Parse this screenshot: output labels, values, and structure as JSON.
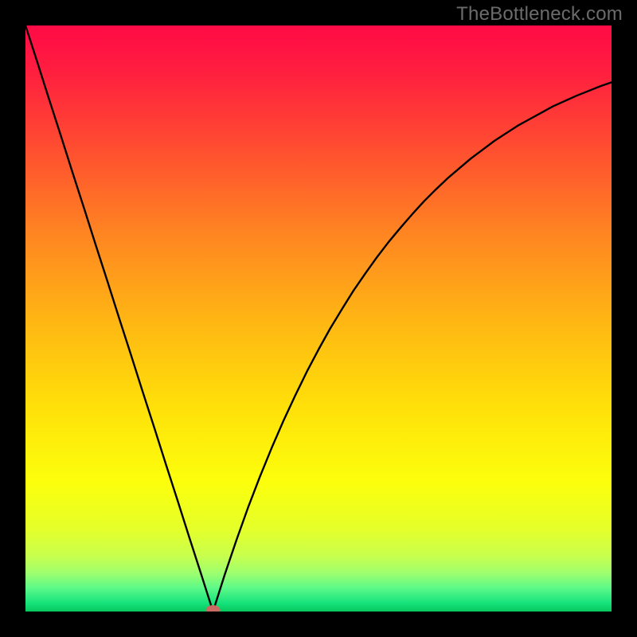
{
  "watermark": "TheBottleneck.com",
  "chart_data": {
    "type": "line",
    "title": "",
    "xlabel": "",
    "ylabel": "",
    "xlim": [
      0,
      1
    ],
    "ylim": [
      0,
      1
    ],
    "x_min_point": 0.32,
    "series": [
      {
        "name": "bottleneck-curve",
        "description": "V-shaped curve dipping to 0 near x≈0.32; left branch nearly linear rising to top-left corner; right branch concave rising toward top-right but below the top edge.",
        "x": [
          0.0,
          0.02,
          0.04,
          0.06,
          0.08,
          0.1,
          0.12,
          0.14,
          0.16,
          0.18,
          0.2,
          0.22,
          0.24,
          0.26,
          0.28,
          0.3,
          0.32,
          0.34,
          0.36,
          0.38,
          0.4,
          0.42,
          0.44,
          0.46,
          0.48,
          0.5,
          0.52,
          0.54,
          0.56,
          0.58,
          0.6,
          0.62,
          0.64,
          0.66,
          0.68,
          0.7,
          0.72,
          0.74,
          0.76,
          0.78,
          0.8,
          0.82,
          0.84,
          0.86,
          0.88,
          0.9,
          0.92,
          0.94,
          0.96,
          0.98,
          1.0
        ],
        "y": [
          1.0,
          0.938,
          0.875,
          0.813,
          0.75,
          0.688,
          0.625,
          0.563,
          0.5,
          0.438,
          0.375,
          0.313,
          0.25,
          0.188,
          0.125,
          0.063,
          0.0,
          0.063,
          0.122,
          0.178,
          0.23,
          0.279,
          0.325,
          0.368,
          0.409,
          0.447,
          0.483,
          0.516,
          0.548,
          0.577,
          0.605,
          0.631,
          0.655,
          0.678,
          0.7,
          0.72,
          0.739,
          0.756,
          0.773,
          0.788,
          0.803,
          0.816,
          0.829,
          0.84,
          0.851,
          0.862,
          0.871,
          0.88,
          0.888,
          0.896,
          0.903
        ]
      }
    ],
    "gradient_stops": [
      {
        "offset": 0.0,
        "color": "#ff0a46"
      },
      {
        "offset": 0.08,
        "color": "#ff1f3f"
      },
      {
        "offset": 0.2,
        "color": "#ff4a31"
      },
      {
        "offset": 0.35,
        "color": "#ff8322"
      },
      {
        "offset": 0.5,
        "color": "#ffb514"
      },
      {
        "offset": 0.65,
        "color": "#ffe009"
      },
      {
        "offset": 0.78,
        "color": "#fcff0c"
      },
      {
        "offset": 0.86,
        "color": "#e4ff2a"
      },
      {
        "offset": 0.905,
        "color": "#c8ff4d"
      },
      {
        "offset": 0.935,
        "color": "#9dff6f"
      },
      {
        "offset": 0.96,
        "color": "#5cf989"
      },
      {
        "offset": 0.985,
        "color": "#17e37c"
      },
      {
        "offset": 1.0,
        "color": "#06c85e"
      }
    ],
    "marker": {
      "x": 0.32,
      "y": 0.0,
      "color": "#c96a63",
      "rx": 9,
      "ry": 6
    }
  }
}
